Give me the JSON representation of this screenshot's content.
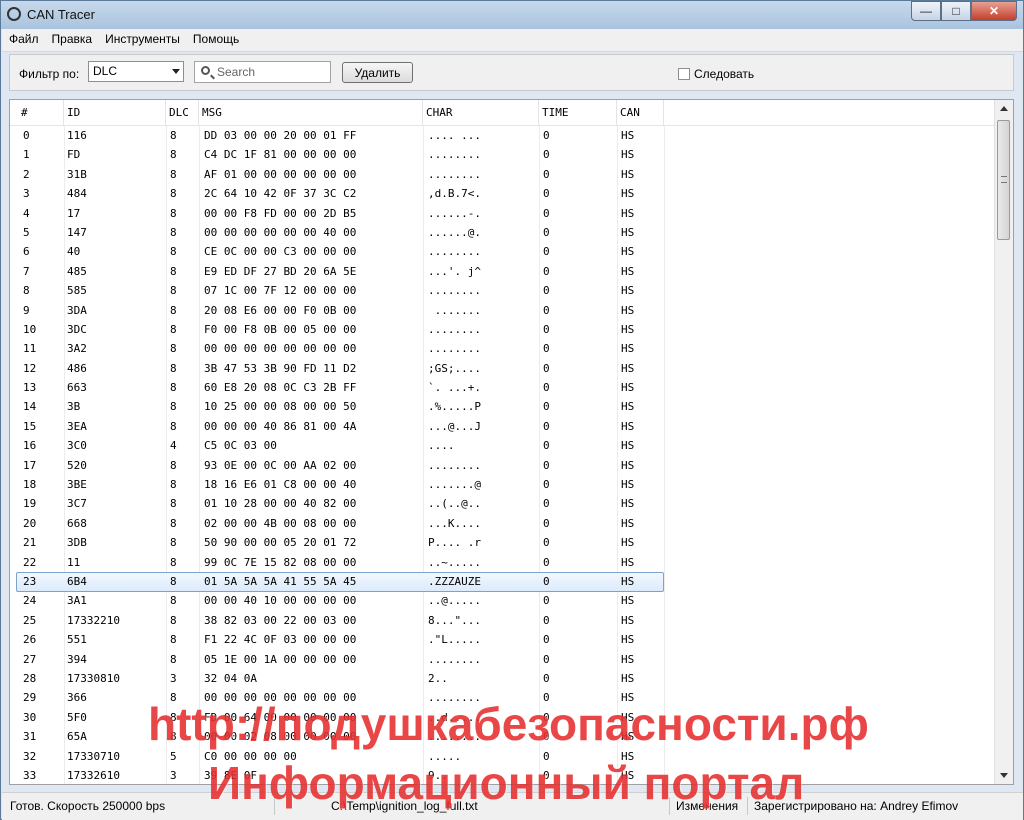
{
  "window": {
    "title": "CAN Tracer",
    "btn_min": "—",
    "btn_max": "□",
    "btn_close": "✕"
  },
  "menu": [
    "Файл",
    "Правка",
    "Инструменты",
    "Помощь"
  ],
  "toolbar": {
    "filter_label": "Фильтр по:",
    "filter_value": "DLC",
    "search_placeholder": "Search",
    "delete_label": "Удалить",
    "follow_label": "Следовать"
  },
  "table": {
    "columns": [
      "#",
      "ID",
      "DLC",
      "MSG",
      "CHAR",
      "TIME",
      "CAN"
    ],
    "selected_row": 23,
    "rows": [
      [
        "0",
        "116",
        "8",
        "DD 03 00 00 20 00 01 FF",
        ".... ...",
        "0",
        "HS"
      ],
      [
        "1",
        "FD",
        "8",
        "C4 DC 1F 81 00 00 00 00",
        "........",
        "0",
        "HS"
      ],
      [
        "2",
        "31B",
        "8",
        "AF 01 00 00 00 00 00 00",
        "........",
        "0",
        "HS"
      ],
      [
        "3",
        "484",
        "8",
        "2C 64 10 42 0F 37 3C C2",
        ",d.B.7<.",
        "0",
        "HS"
      ],
      [
        "4",
        "17",
        "8",
        "00 00 F8 FD 00 00 2D B5",
        "......-.",
        "0",
        "HS"
      ],
      [
        "5",
        "147",
        "8",
        "00 00 00 00 00 00 40 00",
        "......@.",
        "0",
        "HS"
      ],
      [
        "6",
        "40",
        "8",
        "CE 0C 00 00 C3 00 00 00",
        "........",
        "0",
        "HS"
      ],
      [
        "7",
        "485",
        "8",
        "E9 ED DF 27 BD 20 6A 5E",
        "...'. j^",
        "0",
        "HS"
      ],
      [
        "8",
        "585",
        "8",
        "07 1C 00 7F 12 00 00 00",
        "........",
        "0",
        "HS"
      ],
      [
        "9",
        "3DA",
        "8",
        "20 08 E6 00 00 F0 0B 00",
        " .......",
        "0",
        "HS"
      ],
      [
        "10",
        "3DC",
        "8",
        "F0 00 F8 0B 00 05 00 00",
        "........",
        "0",
        "HS"
      ],
      [
        "11",
        "3A2",
        "8",
        "00 00 00 00 00 00 00 00",
        "........",
        "0",
        "HS"
      ],
      [
        "12",
        "486",
        "8",
        "3B 47 53 3B 90 FD 11 D2",
        ";GS;....",
        "0",
        "HS"
      ],
      [
        "13",
        "663",
        "8",
        "60 E8 20 08 0C C3 2B FF",
        "`. ...+.",
        "0",
        "HS"
      ],
      [
        "14",
        "3B",
        "8",
        "10 25 00 00 08 00 00 50",
        ".%.....P",
        "0",
        "HS"
      ],
      [
        "15",
        "3EA",
        "8",
        "00 00 00 40 86 81 00 4A",
        "...@...J",
        "0",
        "HS"
      ],
      [
        "16",
        "3C0",
        "4",
        "C5 0C 03 00",
        "....",
        "0",
        "HS"
      ],
      [
        "17",
        "520",
        "8",
        "93 0E 00 0C 00 AA 02 00",
        "........",
        "0",
        "HS"
      ],
      [
        "18",
        "3BE",
        "8",
        "18 16 E6 01 C8 00 00 40",
        ".......@",
        "0",
        "HS"
      ],
      [
        "19",
        "3C7",
        "8",
        "01 10 28 00 00 40 82 00",
        "..(..@..",
        "0",
        "HS"
      ],
      [
        "20",
        "668",
        "8",
        "02 00 00 4B 00 08 00 00",
        "...K....",
        "0",
        "HS"
      ],
      [
        "21",
        "3DB",
        "8",
        "50 90 00 00 05 20 01 72",
        "P.... .r",
        "0",
        "HS"
      ],
      [
        "22",
        "11",
        "8",
        "99 0C 7E 15 82 08 00 00",
        "..~.....",
        "0",
        "HS"
      ],
      [
        "23",
        "6B4",
        "8",
        "01 5A 5A 5A 41 55 5A 45",
        ".ZZZAUZE",
        "0",
        "HS"
      ],
      [
        "24",
        "3A1",
        "8",
        "00 00 40 10 00 00 00 00",
        "..@.....",
        "0",
        "HS"
      ],
      [
        "25",
        "17332210",
        "8",
        "38 82 03 00 22 00 03 00",
        "8...\"...",
        "0",
        "HS"
      ],
      [
        "26",
        "551",
        "8",
        "F1 22 4C 0F 03 00 00 00",
        ".\"L.....",
        "0",
        "HS"
      ],
      [
        "27",
        "394",
        "8",
        "05 1E 00 1A 00 00 00 00",
        "........",
        "0",
        "HS"
      ],
      [
        "28",
        "17330810",
        "3",
        "32 04 0A",
        "2..",
        "0",
        "HS"
      ],
      [
        "29",
        "366",
        "8",
        "00 00 00 00 00 00 00 00",
        "........",
        "0",
        "HS"
      ],
      [
        "30",
        "5F0",
        "8",
        "FD 00 64 00 00 00 00 00",
        "..d.....",
        "0",
        "HS"
      ],
      [
        "31",
        "65A",
        "8",
        "00 00 02 08 00 00 00 00",
        "........",
        "0",
        "HS"
      ],
      [
        "32",
        "17330710",
        "5",
        "C0 00 00 00 00",
        ".....",
        "0",
        "HS"
      ],
      [
        "33",
        "17332610",
        "3",
        "39 8E 0F",
        "9..",
        "0",
        "HS"
      ]
    ]
  },
  "status": {
    "ready": "Готов. Скорость 250000 bps",
    "file": "C:\\Temp\\ignition_log_full.txt",
    "changes": "Изменения",
    "registered": "Зарегистрировано на: Andrey Efimov"
  },
  "watermark": {
    "line1": "http://подушкабезопасности.рф",
    "line2": "Информационный портал"
  }
}
